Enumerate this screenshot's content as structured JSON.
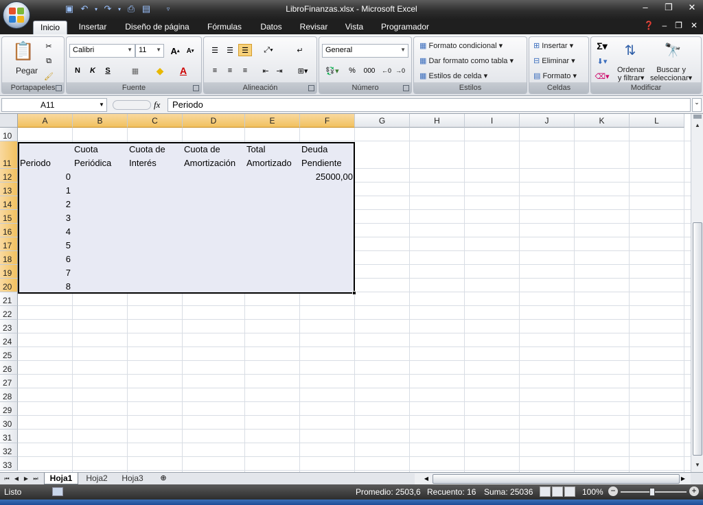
{
  "window": {
    "title": "LibroFinanzas.xlsx - Microsoft Excel",
    "min": "–",
    "max": "❐",
    "close": "✕"
  },
  "qat": [
    "save-icon",
    "undo-icon",
    "redo-icon",
    "print-preview-icon",
    "form-icon",
    "customize-icon"
  ],
  "tabs": [
    "Inicio",
    "Insertar",
    "Diseño de página",
    "Fórmulas",
    "Datos",
    "Revisar",
    "Vista",
    "Programador"
  ],
  "ribbon": {
    "portapapeles": {
      "label": "Portapapeles",
      "paste": "Pegar"
    },
    "fuente": {
      "label": "Fuente",
      "font": "Calibri",
      "size": "11",
      "bold": "N",
      "italic": "K",
      "underline": "S"
    },
    "alineacion": {
      "label": "Alineación"
    },
    "numero": {
      "label": "Número",
      "format": "General",
      "percent": "%",
      "thousands": "000"
    },
    "estilos": {
      "label": "Estilos",
      "cond": "Formato condicional",
      "table": "Dar formato como tabla",
      "cell": "Estilos de celda"
    },
    "celdas": {
      "label": "Celdas",
      "insert": "Insertar",
      "delete": "Eliminar",
      "format": "Formato"
    },
    "modificar": {
      "label": "Modificar",
      "sort_1": "Ordenar",
      "sort_2": "y filtrar",
      "find_1": "Buscar y",
      "find_2": "seleccionar"
    }
  },
  "formula_bar": {
    "name_box": "A11",
    "fx": "fx",
    "content": "Periodo"
  },
  "columns": [
    "A",
    "B",
    "C",
    "D",
    "E",
    "F",
    "G",
    "H",
    "I",
    "J",
    "K",
    "L"
  ],
  "selected_columns": [
    "A",
    "B",
    "C",
    "D",
    "E",
    "F"
  ],
  "rows": [
    "10",
    "11",
    "12",
    "13",
    "14",
    "15",
    "16",
    "17",
    "18",
    "19",
    "20",
    "21",
    "22",
    "23",
    "24",
    "25",
    "26",
    "27",
    "28",
    "29",
    "30",
    "31",
    "32",
    "33"
  ],
  "selected_rows": [
    "11",
    "12",
    "13",
    "14",
    "15",
    "16",
    "17",
    "18",
    "19",
    "20"
  ],
  "table": {
    "headers": {
      "a": "Periodo",
      "b1": "Cuota",
      "b2": "Periódica",
      "c1": "Cuota de",
      "c2": "Interés",
      "d1": "Cuota de",
      "d2": "Amortización",
      "e1": "Total",
      "e2": "Amortizado",
      "f1": "Deuda",
      "f2": "Pendiente"
    },
    "periods": [
      "0",
      "1",
      "2",
      "3",
      "4",
      "5",
      "6",
      "7",
      "8"
    ],
    "initial_debt": "25000,00"
  },
  "sheets": [
    "Hoja1",
    "Hoja2",
    "Hoja3"
  ],
  "active_sheet": "Hoja1",
  "status": {
    "ready": "Listo",
    "average": "Promedio: 2503,6",
    "count": "Recuento: 16",
    "sum": "Suma: 25036",
    "zoom": "100%"
  },
  "colors": {
    "selection_fill": "#e8eaf4",
    "header_selected": "#f1c15f",
    "title_bar": "#2f2f2f"
  }
}
